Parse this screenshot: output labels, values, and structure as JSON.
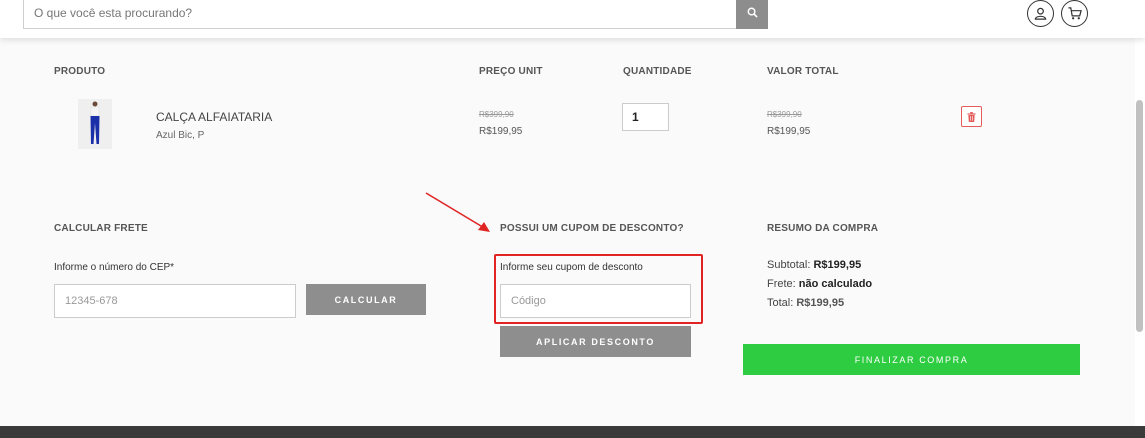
{
  "header": {
    "search_placeholder": "O que você esta procurando?",
    "icons": [
      "search-icon",
      "user-icon",
      "cart-icon"
    ]
  },
  "cart": {
    "columns": [
      "PRODUTO",
      "PREÇO UNIT",
      "QUANTIDADE",
      "VALOR TOTAL"
    ],
    "item": {
      "name": "CALÇA ALFAIATARIA",
      "variant": "Azul Bic, P",
      "unit_price_old": "R$399,90",
      "unit_price": "R$199,95",
      "quantity": "1",
      "total_old": "R$399,90",
      "total": "R$199,95"
    }
  },
  "shipping": {
    "title": "CALCULAR FRETE",
    "label": "Informe o número do CEP*",
    "placeholder": "12345-678",
    "button": "CALCULAR"
  },
  "coupon": {
    "title": "POSSUI UM CUPOM DE DESCONTO?",
    "label": "Informe seu cupom de desconto",
    "placeholder": "Código",
    "button": "APLICAR DESCONTO"
  },
  "summary": {
    "title": "RESUMO DA COMPRA",
    "subtotal_label": "Subtotal:",
    "subtotal_value": "R$199,95",
    "frete_label": "Frete:",
    "frete_value": "não calculado",
    "total_label": "Total:",
    "total_value": "R$199,95",
    "checkout_button": "FINALIZAR COMPRA"
  },
  "colors": {
    "accent_green": "#2ecc40",
    "annotation_red": "#e02424",
    "button_gray": "#8e8e8e"
  }
}
